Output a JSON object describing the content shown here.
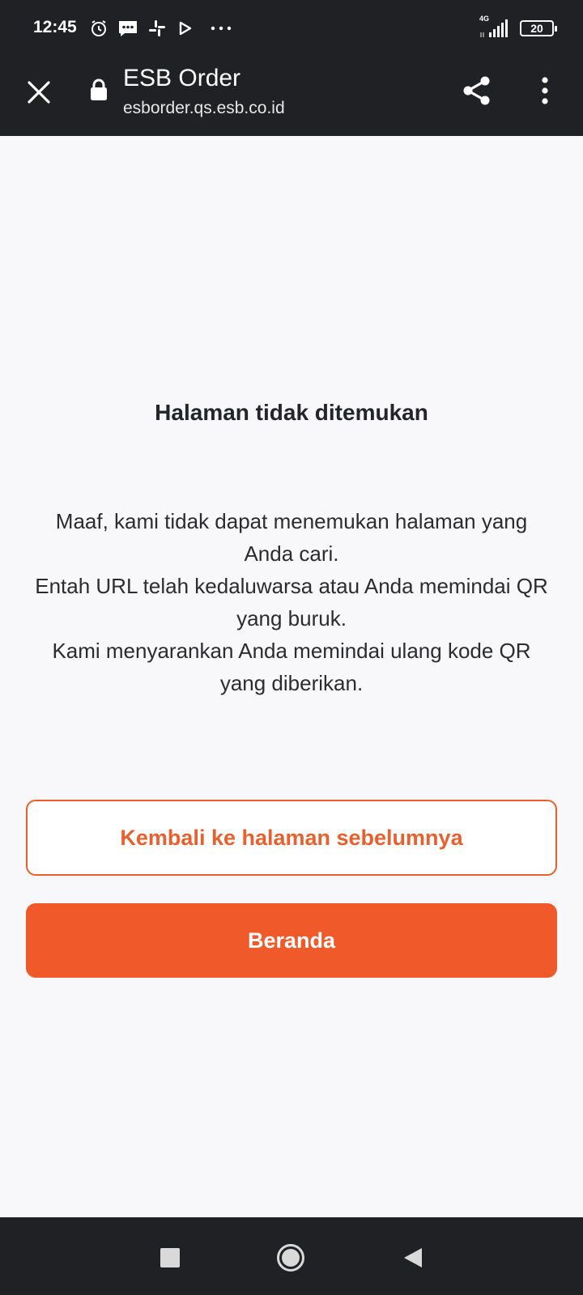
{
  "status_bar": {
    "time": "12:45",
    "network": "4G",
    "battery": "20",
    "icons": [
      "alarm-icon",
      "message-icon",
      "slack-icon",
      "play-icon",
      "more-dots-icon",
      "signal-icon",
      "battery-icon"
    ]
  },
  "toolbar": {
    "title": "ESB Order",
    "url": "esborder.qs.esb.co.id",
    "icons": [
      "close-icon",
      "lock-icon",
      "share-icon",
      "more-vert-icon"
    ]
  },
  "page": {
    "heading": "Halaman tidak ditemukan",
    "message_lines": [
      "Maaf, kami tidak dapat menemukan halaman yang Anda cari.",
      "Entah URL telah kedaluwarsa atau Anda memindai QR yang buruk.",
      "Kami menyarankan Anda memindai ulang kode QR yang diberikan."
    ],
    "back_button_label": "Kembali ke halaman sebelumnya",
    "home_button_label": "Beranda"
  },
  "colors": {
    "accent": "#f05a2a",
    "bar_background": "#202124",
    "page_background": "#f8f8fa"
  },
  "nav_bar": {
    "icons": [
      "recents-square-icon",
      "home-circle-icon",
      "back-triangle-icon"
    ]
  }
}
